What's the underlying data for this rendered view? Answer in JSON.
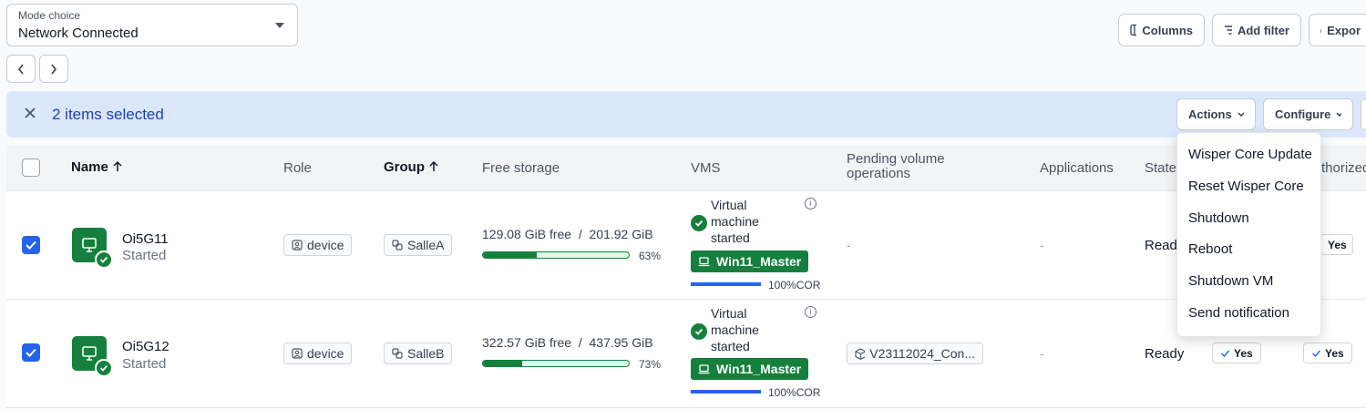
{
  "mode_select": {
    "label": "Mode choice",
    "value": "Network Connected"
  },
  "toolbar": {
    "columns": "Columns",
    "add_filter": "Add filter",
    "export": "Expor"
  },
  "selection": {
    "text": "2 items selected",
    "actions": "Actions",
    "configure": "Configure"
  },
  "table": {
    "headers": {
      "name": "Name",
      "role": "Role",
      "group": "Group",
      "free_storage": "Free storage",
      "vms": "VMS",
      "pending": "Pending volume operations",
      "applications": "Applications",
      "state": "State",
      "authorized": "thorized"
    },
    "rows": [
      {
        "name": "Oi5G11",
        "status": "Started",
        "role": "device",
        "group": "SalleA",
        "storage_free": "129.08 GiB free",
        "storage_sep": "/",
        "storage_total": "201.92 GiB",
        "storage_pct": "63%",
        "storage_fraction": 0.37,
        "vm_status": [
          "Virtual",
          "machine",
          "started"
        ],
        "vm_name": "Win11_Master",
        "vm_cor": "100%COR",
        "pending": "-",
        "applications": "-",
        "state": "Read",
        "authorized": "Yes"
      },
      {
        "name": "Oi5G12",
        "status": "Started",
        "role": "device",
        "group": "SalleB",
        "storage_free": "322.57 GiB free",
        "storage_sep": "/",
        "storage_total": "437.95 GiB",
        "storage_pct": "73%",
        "storage_fraction": 0.27,
        "vm_status": [
          "Virtual",
          "machine",
          "started"
        ],
        "vm_name": "Win11_Master",
        "vm_cor": "100%COR",
        "pending": "V23112024_Con...",
        "applications": "-",
        "state": "Ready",
        "state_yes": "Yes",
        "authorized": "Yes"
      }
    ]
  },
  "actions_menu": [
    "Wisper Core Update",
    "Reset Wisper Core",
    "Shutdown",
    "Reboot",
    "Shutdown VM",
    "Send notification"
  ],
  "colors": {
    "accent": "#2563eb",
    "success": "#15803d",
    "selection_bg": "#dbe8fb"
  }
}
